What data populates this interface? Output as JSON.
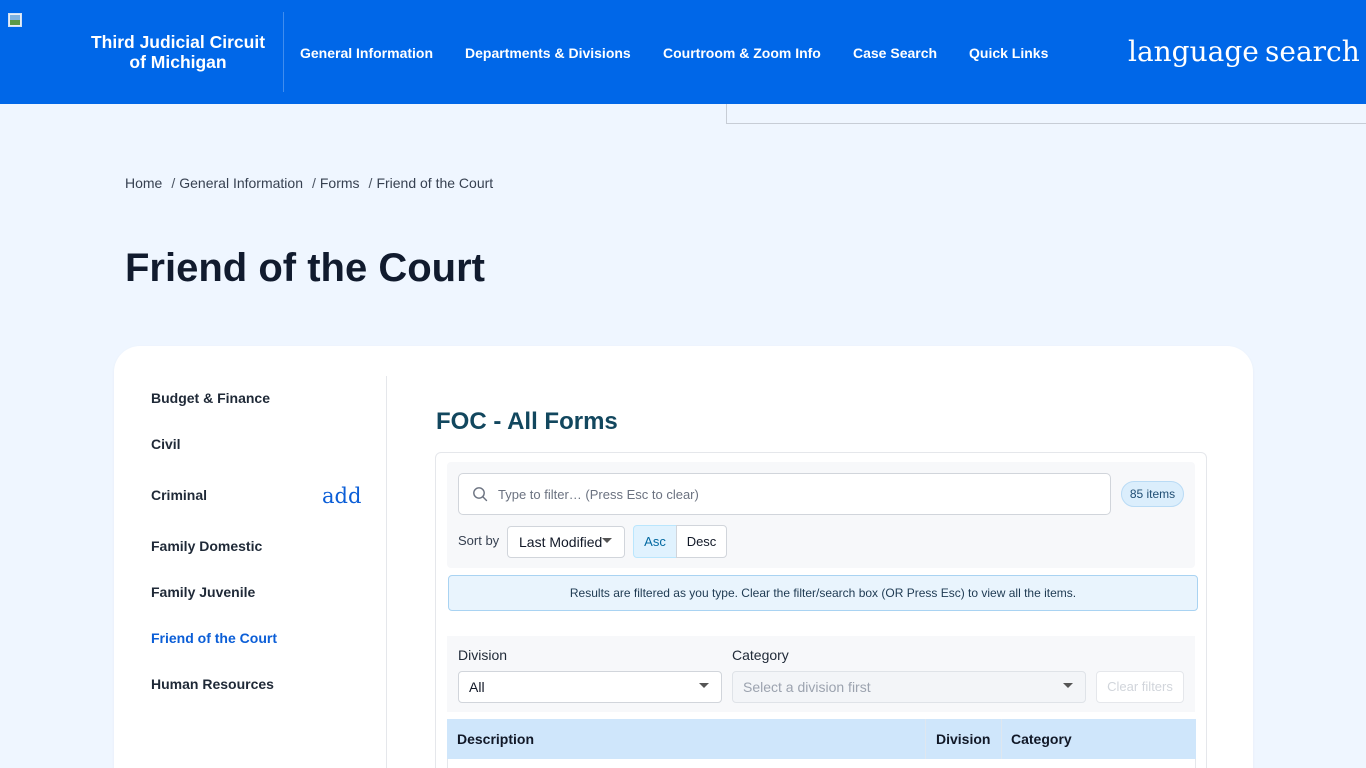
{
  "header": {
    "site_title_line1": "Third Judicial Circuit",
    "site_title_line2": "of Michigan",
    "nav": [
      {
        "label": "General Information"
      },
      {
        "label": "Departments & Divisions"
      },
      {
        "label": "Courtroom & Zoom Info"
      },
      {
        "label": "Case Search"
      },
      {
        "label": "Quick Links"
      }
    ],
    "language_icon_text": "language",
    "search_icon_text": "search"
  },
  "breadcrumb": {
    "items": [
      "Home",
      "General Information",
      "Forms",
      "Friend of the Court"
    ],
    "separator": "/"
  },
  "page_title": "Friend of the Court",
  "sidebar": {
    "items": [
      {
        "label": "Budget & Finance"
      },
      {
        "label": "Civil"
      },
      {
        "label": "Criminal"
      },
      {
        "label": "Family Domestic"
      },
      {
        "label": "Family Juvenile"
      },
      {
        "label": "Friend of the Court",
        "active": true
      },
      {
        "label": "Human Resources"
      }
    ],
    "expand_icon_text": "add"
  },
  "forms": {
    "title": "FOC - All Forms",
    "search_placeholder": "Type to filter… (Press Esc to clear)",
    "count_badge": "85 items",
    "sort_label": "Sort by",
    "sort_value": "Last Modified",
    "asc_label": "Asc",
    "desc_label": "Desc",
    "info_text": "Results are filtered as you type. Clear the filter/search box (OR Press Esc) to view all the items.",
    "division_label": "Division",
    "division_value": "All",
    "category_label": "Category",
    "category_value": "Select a division first",
    "clear_filters_label": "Clear filters",
    "columns": [
      "Description",
      "Division",
      "Category"
    ]
  },
  "colors": {
    "header_bg": "#0067e8",
    "accent": "#0b5ed7",
    "page_bg": "#eff6ff"
  }
}
